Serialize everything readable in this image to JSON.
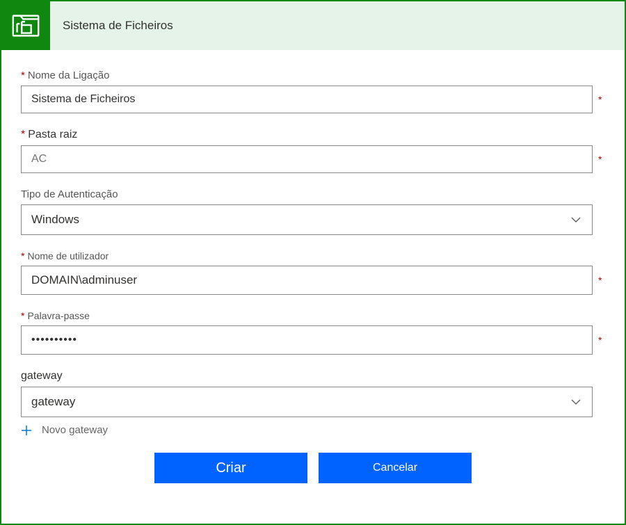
{
  "header": {
    "title": "Sistema de Ficheiros"
  },
  "form": {
    "connection_name": {
      "label": "Nome da Ligação",
      "value": "Sistema de Ficheiros"
    },
    "root_folder": {
      "label": "Pasta raiz",
      "placeholder": "AC"
    },
    "auth_type": {
      "label": "Tipo de Autenticação",
      "value": "Windows"
    },
    "username": {
      "label": "Nome de utilizador",
      "value": "DOMAIN\\adminuser"
    },
    "password": {
      "label": "Palavra-passe",
      "value": "••••••••••"
    },
    "gateway": {
      "label": "gateway",
      "value": "gateway",
      "new_gateway_label": "Novo gateway"
    }
  },
  "buttons": {
    "create": "Criar",
    "cancel": "Cancelar"
  }
}
